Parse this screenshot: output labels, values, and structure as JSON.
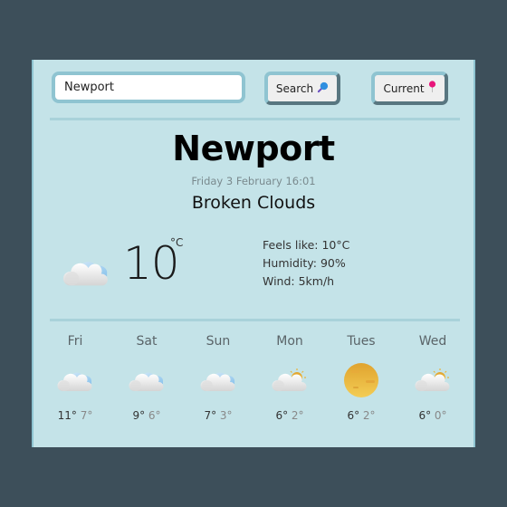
{
  "search": {
    "value": "Newport",
    "search_label": "Search",
    "current_label": "Current"
  },
  "current": {
    "city": "Newport",
    "datetime": "Friday 3 February 16:01",
    "description": "Broken Clouds",
    "temperature": "10",
    "unit": "°C",
    "icon": "broken-clouds",
    "details": {
      "feels_like": "Feels like: 10°C",
      "humidity": "Humidity: 90%",
      "wind": "Wind: 5km/h"
    }
  },
  "forecast": [
    {
      "day": "Fri",
      "icon": "broken-clouds",
      "high": "11°",
      "low": "7°"
    },
    {
      "day": "Sat",
      "icon": "broken-clouds",
      "high": "9°",
      "low": "6°"
    },
    {
      "day": "Sun",
      "icon": "broken-clouds",
      "high": "7°",
      "low": "3°"
    },
    {
      "day": "Mon",
      "icon": "partly-cloudy",
      "high": "6°",
      "low": "2°"
    },
    {
      "day": "Tues",
      "icon": "clear-sky",
      "high": "6°",
      "low": "2°"
    },
    {
      "day": "Wed",
      "icon": "partly-cloudy",
      "high": "6°",
      "low": "0°"
    }
  ]
}
